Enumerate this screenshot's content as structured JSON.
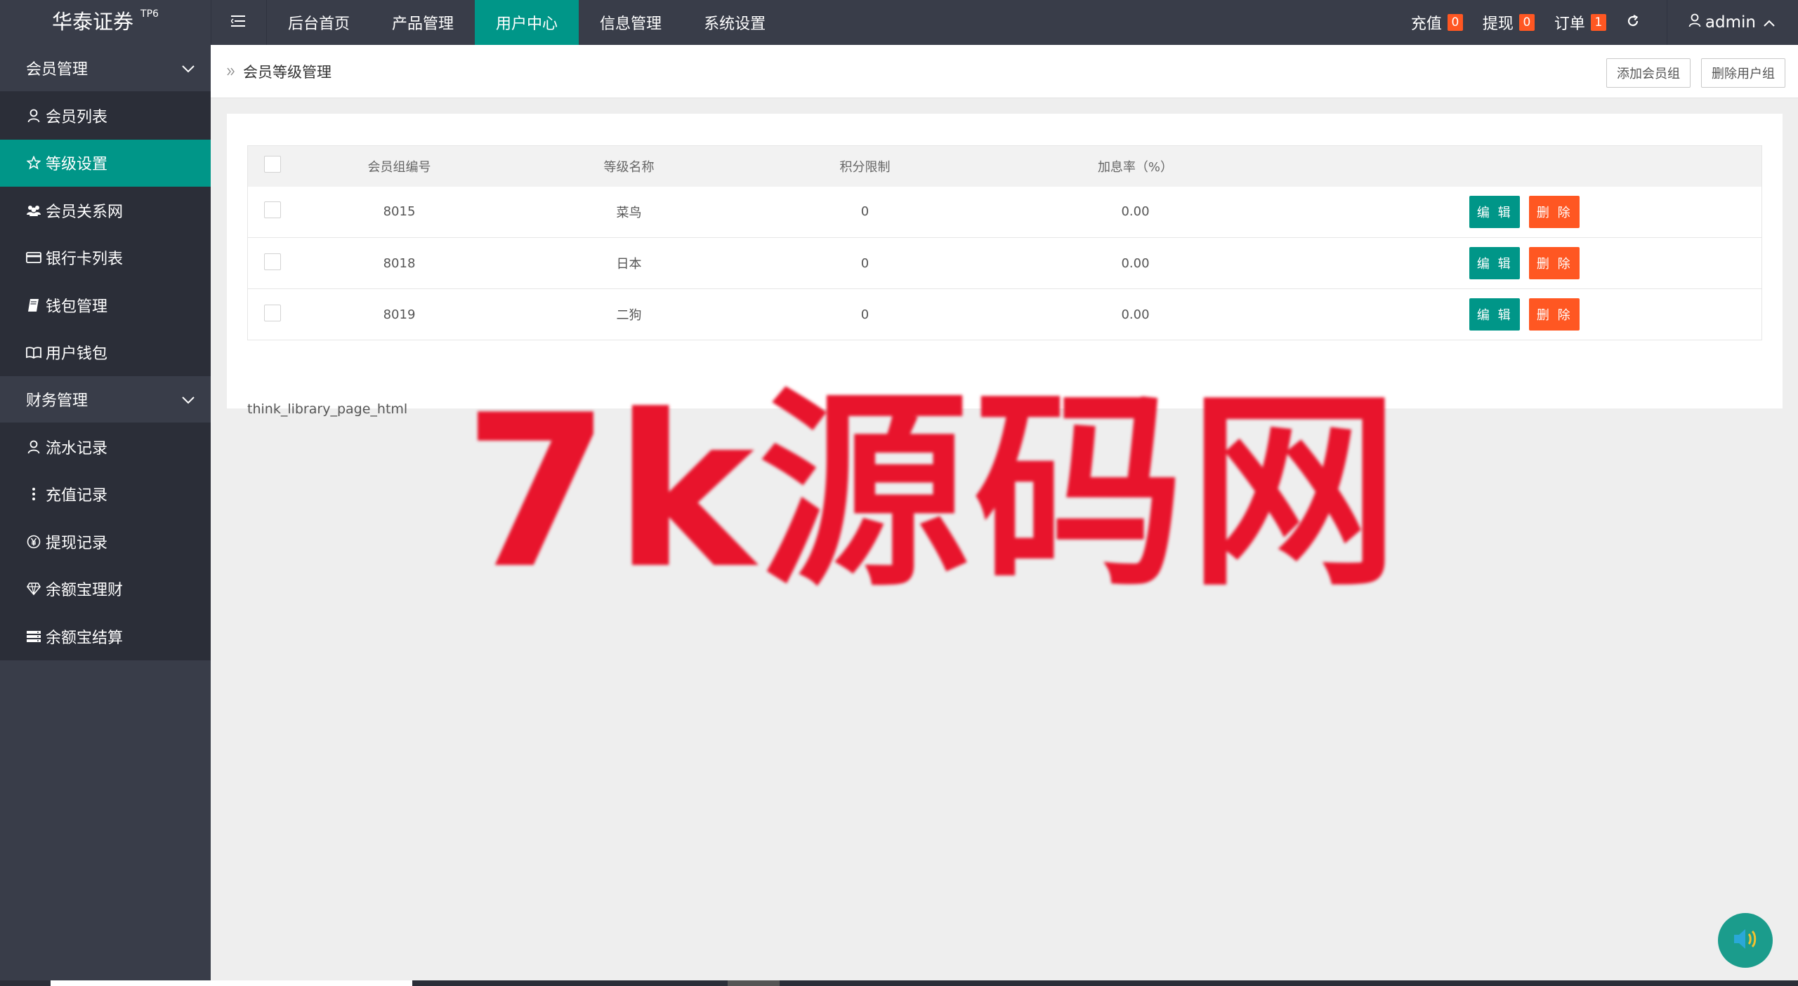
{
  "header": {
    "logo": "华泰证券",
    "logo_sup": "TP6",
    "nav": [
      "后台首页",
      "产品管理",
      "用户中心",
      "信息管理",
      "系统设置"
    ],
    "active_nav": "用户中心",
    "stats": [
      {
        "label": "充值",
        "count": "0"
      },
      {
        "label": "提现",
        "count": "0"
      },
      {
        "label": "订单",
        "count": "1"
      }
    ],
    "user": "admin"
  },
  "sidebar": {
    "groups": [
      {
        "title": "会员管理",
        "items": [
          {
            "label": "会员列表",
            "icon": "user-icon"
          },
          {
            "label": "等级设置",
            "icon": "star-icon",
            "active": true
          },
          {
            "label": "会员关系网",
            "icon": "users-icon"
          },
          {
            "label": "银行卡列表",
            "icon": "credit-card-icon"
          },
          {
            "label": "钱包管理",
            "icon": "book-icon"
          },
          {
            "label": "用户钱包",
            "icon": "open-book-icon"
          }
        ]
      },
      {
        "title": "财务管理",
        "items": [
          {
            "label": "流水记录",
            "icon": "user-icon"
          },
          {
            "label": "充值记录",
            "icon": "vertical-dots-icon"
          },
          {
            "label": "提现记录",
            "icon": "yen-icon"
          },
          {
            "label": "余额宝理财",
            "icon": "diamond-icon"
          },
          {
            "label": "余额宝结算",
            "icon": "server-icon"
          }
        ]
      }
    ]
  },
  "main": {
    "breadcrumb": "会员等级管理",
    "actions": [
      "添加会员组",
      "删除用户组"
    ],
    "table": {
      "headers": [
        "会员组编号",
        "等级名称",
        "积分限制",
        "加息率（%）"
      ],
      "rows": [
        {
          "id": "8015",
          "name": "菜鸟",
          "points": "0",
          "rate": "0.00"
        },
        {
          "id": "8018",
          "name": "日本",
          "points": "0",
          "rate": "0.00"
        },
        {
          "id": "8019",
          "name": "二狗",
          "points": "0",
          "rate": "0.00"
        }
      ],
      "edit_label": "编 辑",
      "delete_label": "删 除"
    },
    "page_html": "think_library_page_html"
  },
  "watermark": "7k源码网",
  "colors": {
    "primary": "#009688",
    "danger": "#ff5722",
    "dark": "#393d49"
  }
}
